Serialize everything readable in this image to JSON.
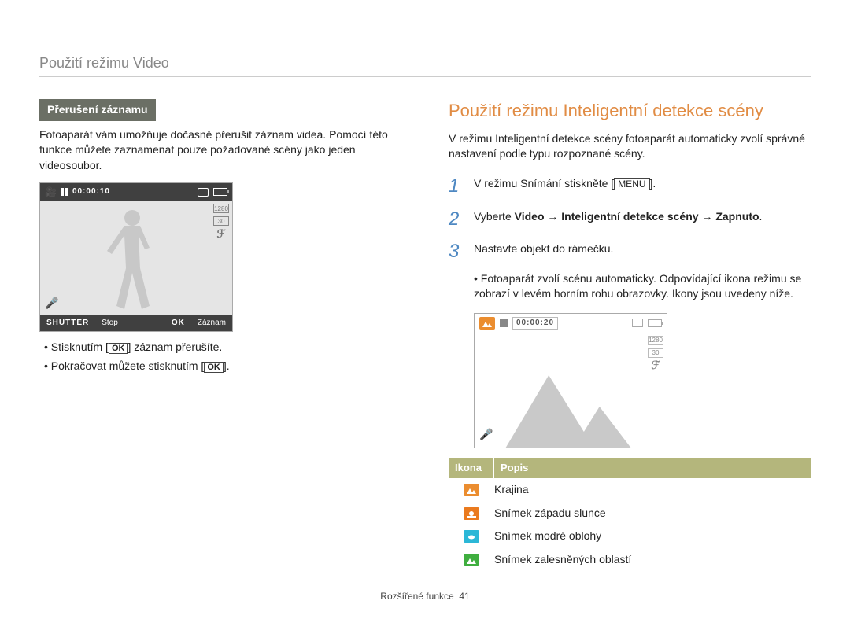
{
  "page_title": "Použití režimu Video",
  "left": {
    "badge": "Přerušení záznamu",
    "para": "Fotoaparát vám umožňuje dočasně přerušit záznam videa. Pomocí této funkce můžete zaznamenat pouze požadované scény jako jeden videosoubor.",
    "lcd": {
      "time": "00:00:10",
      "shutter_label": "SHUTTER",
      "stop": "Stop",
      "ok_label": "OK",
      "zaznam": "Záznam",
      "res": "1280",
      "fps": "30"
    },
    "bullets": [
      {
        "pre": "Stisknutím [",
        "btn": "OK",
        "post": "] záznam přerušíte."
      },
      {
        "pre": "Pokračovat můžete stisknutím [",
        "btn": "OK",
        "post": "]."
      }
    ]
  },
  "right": {
    "heading": "Použití režimu Inteligentní detekce scény",
    "intro": "V režimu Inteligentní detekce scény fotoaparát automaticky zvolí správné nastavení podle typu rozpoznané scény.",
    "steps": [
      {
        "num": "1",
        "pre": "V režimu Snímání stiskněte [",
        "btn": "MENU",
        "post": "]."
      },
      {
        "num": "2",
        "text": "Vyberte Video → Inteligentní detekce scény → Zapnuto.",
        "bold": true
      },
      {
        "num": "3",
        "text": "Nastavte objekt do rámečku."
      }
    ],
    "sub_bullets": [
      "Fotoaparát zvolí scénu automaticky. Odpovídající ikona režimu se zobrazí v levém horním rohu obrazovky. Ikony jsou uvedeny níže."
    ],
    "lcd": {
      "time": "00:00:20",
      "res": "1280",
      "fps": "30"
    },
    "table": {
      "head_ikona": "Ikona",
      "head_popis": "Popis",
      "rows": [
        {
          "icon": "landscape",
          "color": "orange",
          "label": "Krajina"
        },
        {
          "icon": "sunset",
          "color": "deep",
          "label": "Snímek západu slunce"
        },
        {
          "icon": "sky",
          "color": "cyan",
          "label": "Snímek modré oblohy"
        },
        {
          "icon": "forest",
          "color": "green",
          "label": "Snímek zalesněných oblastí"
        }
      ]
    }
  },
  "footer": {
    "section": "Rozšířené funkce",
    "page": "41"
  }
}
